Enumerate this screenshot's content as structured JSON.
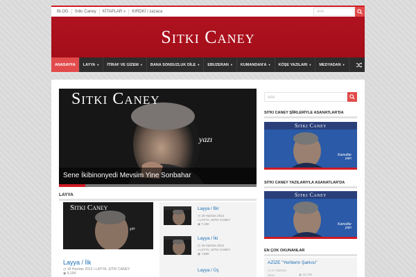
{
  "topbar": {
    "links": [
      "BLOG",
      "Sıtkı Caney",
      "KİTAPLAR »",
      "KIRDKİ / zazaca"
    ],
    "search_placeholder": "ARA"
  },
  "header": {
    "logo": "Sıtkı Caney"
  },
  "nav": {
    "items": [
      {
        "label": "ANASAYFA",
        "active": true,
        "dropdown": false
      },
      {
        "label": "LAYYA",
        "active": false,
        "dropdown": true
      },
      {
        "label": "İTİRAF VE GİZEM",
        "active": false,
        "dropdown": true
      },
      {
        "label": "BANA SONSUZLUK DİLE",
        "active": false,
        "dropdown": true
      },
      {
        "label": "EBUZERAN",
        "active": false,
        "dropdown": true
      },
      {
        "label": "KUMANDAN'A",
        "active": false,
        "dropdown": true
      },
      {
        "label": "KÖŞE YAZILARI",
        "active": false,
        "dropdown": true
      },
      {
        "label": "MEDYADAN",
        "active": false,
        "dropdown": true
      }
    ],
    "shuffle_icon": "shuffle-icon"
  },
  "slider": {
    "brand": "Sıtkı Caney",
    "overlay_word": "yazı",
    "caption": "Sene İkibinonyedi Mevsim Yine Sonbahar"
  },
  "section": {
    "title": "LAYYA",
    "main_post": {
      "thumb_brand": "Sıtkı Caney",
      "thumb_word": "şiir",
      "title": "Layya / İlk",
      "date": "18 Haziran 2012",
      "categories": "LAYYA, SITKI CANEY",
      "views": "9,194"
    },
    "list": [
      {
        "title": "Layya / Bir",
        "date": "18 Haziran 2012",
        "categories": "LAYYA, SITKI CANEY",
        "views": "7,190"
      },
      {
        "title": "Layya / İki",
        "date": "18 Haziran 2012",
        "categories": "LAYYA, SITKI CANEY",
        "views": "7,880"
      },
      {
        "title": "Layya / Üç"
      }
    ]
  },
  "sidebar": {
    "search_placeholder": "ARA",
    "widget1_title": "SITKI CANEY ŞİİRLERİYLE ASANATLAR'DA",
    "widget2_title": "SITKI CANEY YAZILARIYLA ASANATLAR'DA",
    "banner_brand": "Sıtkı Caney",
    "banner_sig1": "Kamuflar",
    "banner_sig2": "yazı",
    "most_read_title": "EN ÇOK OKUNANLAR",
    "most_read": {
      "title": "AZİZE \"Yerlilerin Şarkısı\"",
      "date": "17 Haziran",
      "year": "2012",
      "views": "18,786"
    }
  },
  "colors": {
    "brand_red": "#b01220",
    "accent_red": "#e24b4b",
    "nav_dark": "#2d2d2d",
    "link_blue": "#1a6eb3"
  }
}
